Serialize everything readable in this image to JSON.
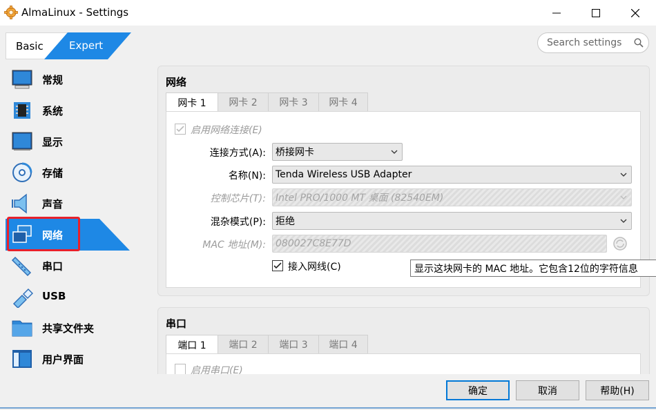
{
  "window": {
    "title": "AlmaLinux - Settings"
  },
  "mode": {
    "basic": "Basic",
    "expert": "Expert"
  },
  "search": {
    "placeholder": "Search settings"
  },
  "sidebar": {
    "items": [
      {
        "label": "常规",
        "icon": "general-monitor-icon"
      },
      {
        "label": "系统",
        "icon": "chip-icon"
      },
      {
        "label": "显示",
        "icon": "display-icon"
      },
      {
        "label": "存储",
        "icon": "storage-disk-icon"
      },
      {
        "label": "声音",
        "icon": "speaker-icon"
      },
      {
        "label": "网络",
        "icon": "network-icon",
        "active": true
      },
      {
        "label": "串口",
        "icon": "serial-port-icon"
      },
      {
        "label": "USB",
        "icon": "usb-icon"
      },
      {
        "label": "共享文件夹",
        "icon": "shared-folder-icon"
      },
      {
        "label": "用户界面",
        "icon": "user-interface-icon"
      }
    ]
  },
  "network": {
    "title": "网络",
    "tabs": [
      "网卡 1",
      "网卡 2",
      "网卡 3",
      "网卡 4"
    ],
    "enable_label": "启用网络连接(E)",
    "attach_label": "连接方式(A):",
    "attach_value": "桥接网卡",
    "name_label": "名称(N):",
    "name_value": "Tenda Wireless USB Adapter",
    "adapter_label": "控制芯片(T):",
    "adapter_value": "Intel PRO/1000 MT 桌面 (82540EM)",
    "promisc_label": "混杂模式(P):",
    "promisc_value": "拒绝",
    "mac_label": "MAC 地址(M):",
    "mac_value": "080027C8E77D",
    "cable_label": "接入网线(C)"
  },
  "tooltip": "显示这块网卡的 MAC 地址。它包含12位的字符信息",
  "serial": {
    "title": "串口",
    "tabs": [
      "端口 1",
      "端口 2",
      "端口 3",
      "端口 4"
    ],
    "enable_label": "启用串口(E)"
  },
  "buttons": {
    "ok": "确定",
    "cancel": "取消",
    "help": "帮助(H)"
  },
  "colors": {
    "accent": "#1e88e5",
    "highlight_outline": "#e8202a"
  }
}
